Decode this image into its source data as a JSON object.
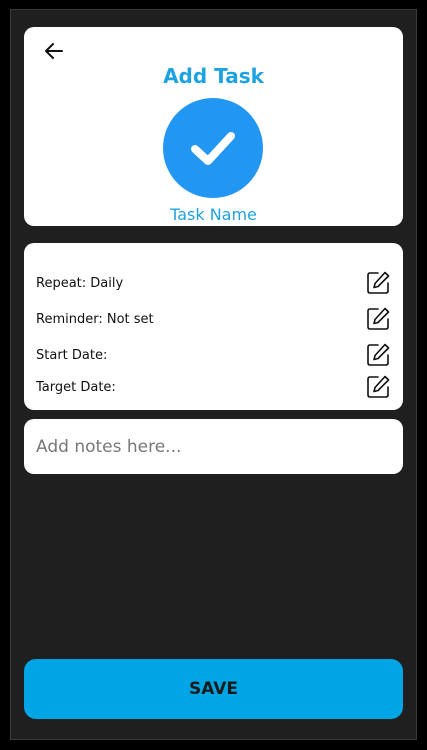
{
  "header": {
    "title": "Add Task",
    "task_name": "Task Name"
  },
  "details": {
    "rows": [
      {
        "label": "Repeat: Daily"
      },
      {
        "label": "Reminder: Not set"
      },
      {
        "label": "Start Date:"
      },
      {
        "label": "Target Date:"
      }
    ]
  },
  "notes": {
    "placeholder": "Add notes here...",
    "value": ""
  },
  "footer": {
    "save_label": "SAVE"
  },
  "colors": {
    "accent": "#1fa3e0",
    "check_circle": "#2196f3",
    "save_button": "#00a5e6",
    "background": "#1f1f1f",
    "card": "#ffffff"
  },
  "icons": {
    "back": "arrow-left-icon",
    "check": "checkmark-icon",
    "edit": "edit-pencil-icon"
  }
}
